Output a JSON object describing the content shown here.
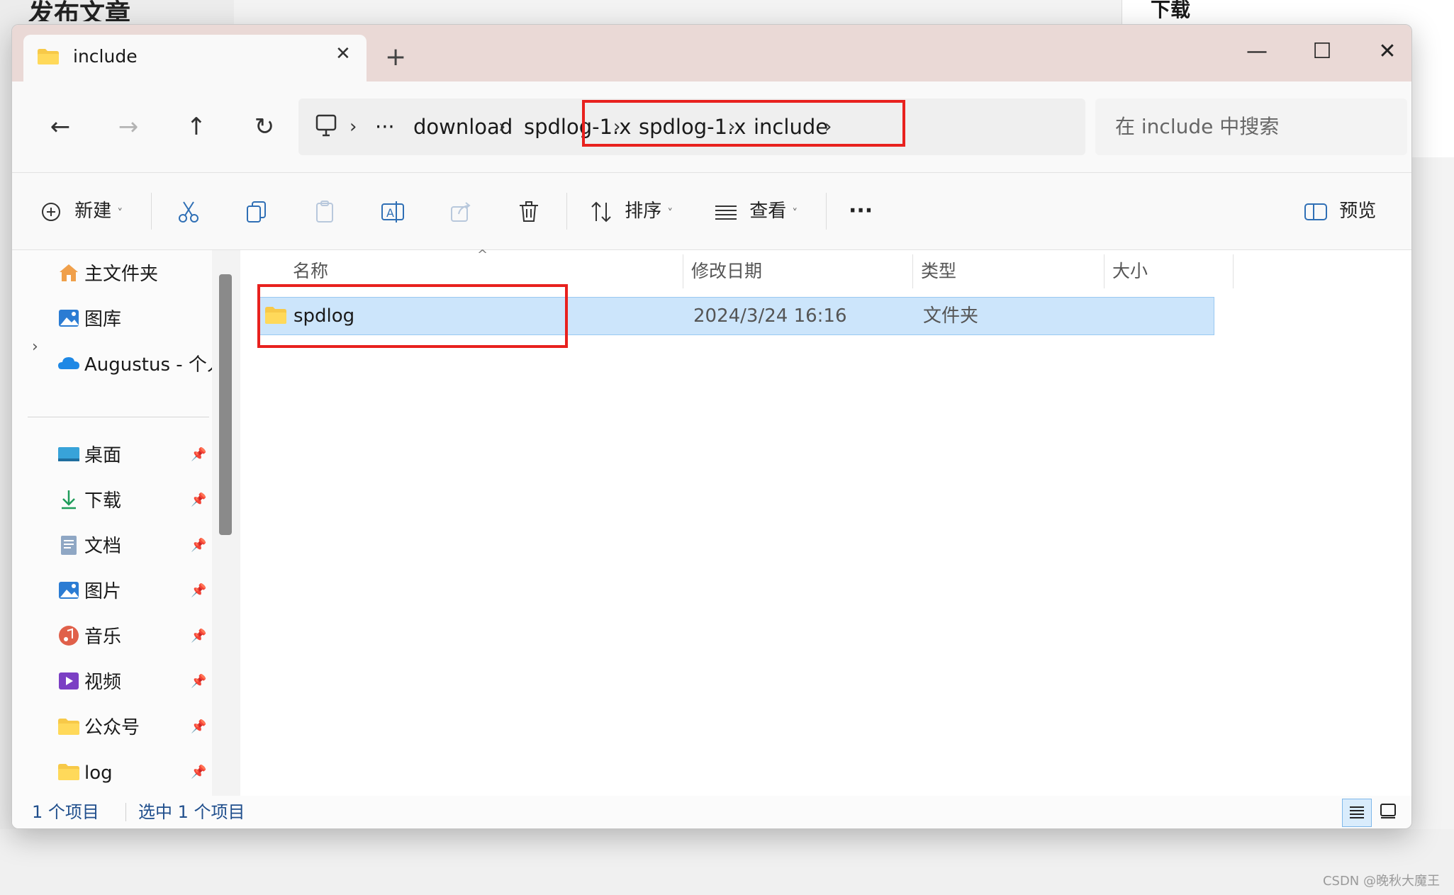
{
  "window": {
    "tab_title": "include",
    "new_tab_label": "+",
    "close_tab_label": "✕",
    "minimize_label": "—",
    "maximize_label": "☐",
    "close_window_label": "✕"
  },
  "nav": {
    "back_icon": "←",
    "forward_icon": "→",
    "up_icon": "↑",
    "refresh_icon": "↻",
    "breadcrumb": [
      "download",
      "spdlog-1.x",
      "spdlog-1.x",
      "include"
    ],
    "overflow_label": "···",
    "separator": "›",
    "search_placeholder": "在 include 中搜索"
  },
  "toolbar": {
    "new_label": "新建",
    "sort_label": "排序",
    "view_label": "查看",
    "more_label": "···",
    "preview_label": "预览"
  },
  "sidebar": {
    "home": "主文件夹",
    "gallery": "图库",
    "onedrive": "Augustus - 个人",
    "desktop": "桌面",
    "downloads": "下载",
    "documents": "文档",
    "pictures": "图片",
    "music": "音乐",
    "videos": "视频",
    "public_account": "公众号",
    "log": "log"
  },
  "columns": {
    "name": "名称",
    "modified": "修改日期",
    "type": "类型",
    "size": "大小"
  },
  "rows": [
    {
      "name": "spdlog",
      "modified": "2024/3/24 16:16",
      "type": "文件夹",
      "size": ""
    }
  ],
  "status": {
    "count": "1 个项目",
    "selected": "选中 1 个项目"
  },
  "background": {
    "left_title": "发布文章",
    "right_title": "下载",
    "watermark": "CSDN @晚秋大魔王"
  },
  "colors": {
    "titlebar": "#ead9d6",
    "selection": "#cce5fb",
    "highlight_box": "#e8211e",
    "status_text": "#1f4e8c"
  }
}
